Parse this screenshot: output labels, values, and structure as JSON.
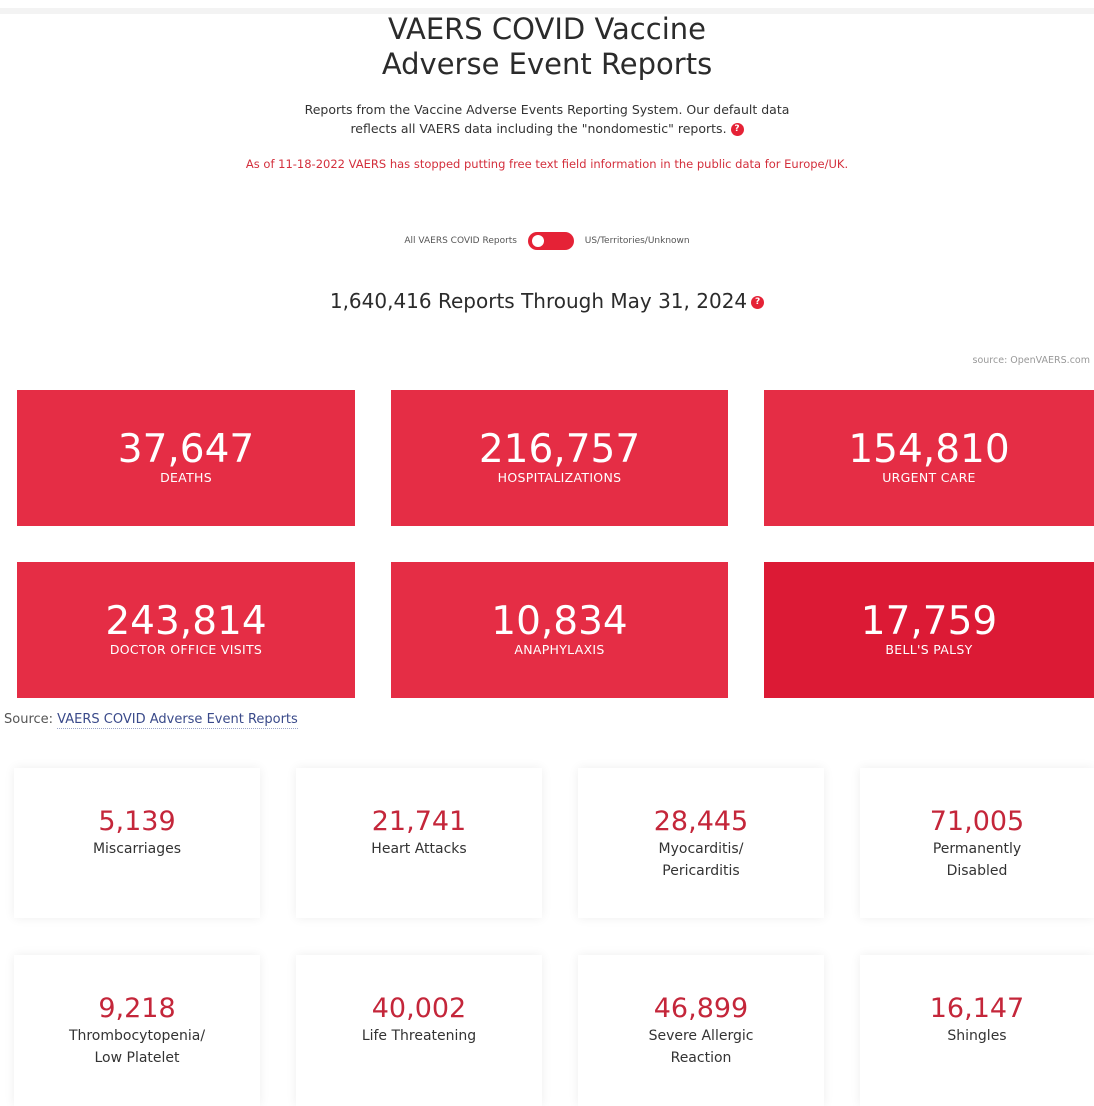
{
  "header": {
    "title_line1": "VAERS COVID Vaccine",
    "title_line2": "Adverse Event Reports",
    "intro_line1": "Reports from the Vaccine Adverse Events Reporting System. Our default data",
    "intro_line2": "reflects all VAERS data including the \"nondomestic\" reports.",
    "help_glyph": "?",
    "warning": "As of 11-18-2022 VAERS has stopped putting free text field information in the public data for Europe/UK."
  },
  "toggle": {
    "left_label": "All VAERS COVID Reports",
    "right_label": "US/Territories/Unknown"
  },
  "report_count": "1,640,416 Reports Through May 31, 2024",
  "source_small": "source: OpenVAERS.com",
  "big_stats": [
    {
      "value": "37,647",
      "label": "DEATHS"
    },
    {
      "value": "216,757",
      "label": "HOSPITALIZATIONS"
    },
    {
      "value": "154,810",
      "label": "URGENT CARE"
    },
    {
      "value": "243,814",
      "label": "DOCTOR OFFICE VISITS"
    },
    {
      "value": "10,834",
      "label": "ANAPHYLAXIS"
    },
    {
      "value": "17,759",
      "label": "BELL'S PALSY"
    }
  ],
  "source_line": {
    "prefix": "Source:",
    "link_text": "VAERS COVID Adverse Event Reports"
  },
  "cards": [
    {
      "value": "5,139",
      "label": "Miscarriages"
    },
    {
      "value": "21,741",
      "label": "Heart Attacks"
    },
    {
      "value": "28,445",
      "label": "Myocarditis/\nPericarditis"
    },
    {
      "value": "71,005",
      "label": "Permanently\nDisabled"
    },
    {
      "value": "9,218",
      "label": "Thrombocytopenia/\nLow Platelet"
    },
    {
      "value": "40,002",
      "label": "Life Threatening"
    },
    {
      "value": "46,899",
      "label": "Severe Allergic\nReaction"
    },
    {
      "value": "16,147",
      "label": "Shingles"
    }
  ],
  "colors": {
    "accent_red": "#e52d45",
    "accent_red_dark": "#dc1a35",
    "card_number": "#c4263a",
    "link": "#3a4a8a"
  }
}
